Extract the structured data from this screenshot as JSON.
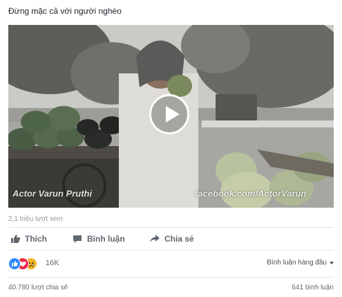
{
  "post": {
    "title": "Đừng mặc cả với người nghèo"
  },
  "video": {
    "watermark_left": "Actor Varun Pruthi",
    "watermark_right": "facebook.com/ActorVarun"
  },
  "stats": {
    "views": "2,1 triệu lượt xem",
    "reaction_count": "16K",
    "shares": "40.780 lượt chia sẻ",
    "comments": "641 bình luận"
  },
  "actions": {
    "like": "Thích",
    "comment": "Bình luận",
    "share": "Chia sẻ"
  },
  "sort_label": "Bình luận hàng đầu",
  "reactions": [
    "like-icon",
    "love-icon",
    "sad-icon"
  ],
  "colors": {
    "like": "#2d88ff",
    "love": "#f0284a",
    "sad": "#f7b125",
    "muted": "#90949c"
  }
}
